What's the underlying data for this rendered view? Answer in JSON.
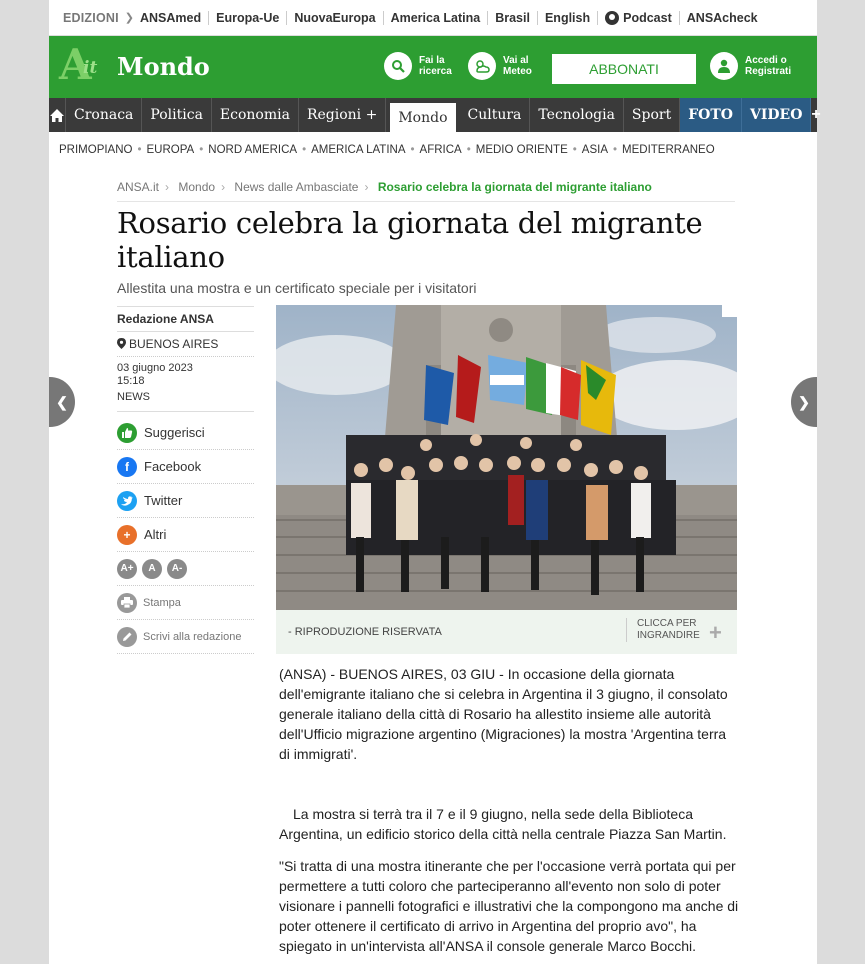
{
  "editions_bar": {
    "label": "EDIZIONI",
    "items": [
      "ANSAmed",
      "Europa-Ue",
      "NuovaEuropa",
      "America Latina",
      "Brasil",
      "English",
      "Podcast",
      "ANSAcheck"
    ]
  },
  "header": {
    "logo_letter": "A",
    "logo_it": "it",
    "section": "Mondo",
    "search_label_1": "Fai la",
    "search_label_2": "ricerca",
    "weather_label_1": "Vai al",
    "weather_label_2": "Meteo",
    "subscribe": "ABBONATI",
    "login_1": "Accedi o",
    "login_2": "Registrati"
  },
  "nav": {
    "items": [
      "Cronaca",
      "Politica",
      "Economia",
      "Regioni +",
      "Mondo",
      "Cultura",
      "Tecnologia",
      "Sport",
      "FOTO",
      "VIDEO"
    ],
    "active": "Mondo",
    "more": "+"
  },
  "subnav": {
    "items": [
      "PRIMOPIANO",
      "EUROPA",
      "NORD AMERICA",
      "AMERICA LATINA",
      "AFRICA",
      "MEDIO ORIENTE",
      "ASIA",
      "MEDITERRANEO"
    ]
  },
  "breadcrumb": [
    "ANSA.it",
    "Mondo",
    "News dalle Ambasciate",
    "Rosario celebra la giornata del migrante italiano"
  ],
  "article": {
    "title": "Rosario celebra la giornata del migrante italiano",
    "subtitle": "Allestita una mostra e un certificato speciale per i visitatori",
    "author": "Redazione ANSA",
    "location": "BUENOS AIRES",
    "date": "03 giugno 2023",
    "time": "15:18",
    "category": "NEWS",
    "caption": "- RIPRODUZIONE RISERVATA",
    "enlarge_1": "CLICCA PER",
    "enlarge_2": "INGRANDIRE",
    "paragraph_1": "(ANSA) - BUENOS AIRES, 03 GIU - In occasione della giornata dell'emigrante italiano che si celebra in Argentina il 3 giugno, il consolato generale italiano della città di Rosario ha allestito insieme alle autorità dell'Ufficio migrazione argentino (Migraciones) la mostra 'Argentina terra di immigrati'.",
    "paragraph_2": "La mostra si terrà tra il 7 e il 9 giugno, nella sede della Biblioteca Argentina, un edificio storico della città nella centrale Piazza San Martin.",
    "paragraph_3": "\"Si tratta di una mostra itinerante che per l'occasione verrà portata qui per permettere a tutti coloro che parteciperanno all'evento non solo di poter visionare i pannelli fotografici e illustrativi che la compongono ma anche di poter ottenere il certificato di arrivo in Argentina del proprio avo\", ha spiegato in un'intervista all'ANSA il console generale Marco Bocchi."
  },
  "share": {
    "suggest": "Suggerisci",
    "facebook": "Facebook",
    "twitter": "Twitter",
    "others": "Altri",
    "size_up": "A+",
    "size_reset": "A",
    "size_down": "A-",
    "print": "Stampa",
    "write": "Scrivi alla redazione"
  },
  "colors": {
    "brand_green": "#2d9e32",
    "nav_dark": "#3a3a3a",
    "nav_blue": "#2b5b84",
    "facebook": "#1877f2",
    "twitter": "#1da1f2",
    "others": "#e8702a"
  }
}
